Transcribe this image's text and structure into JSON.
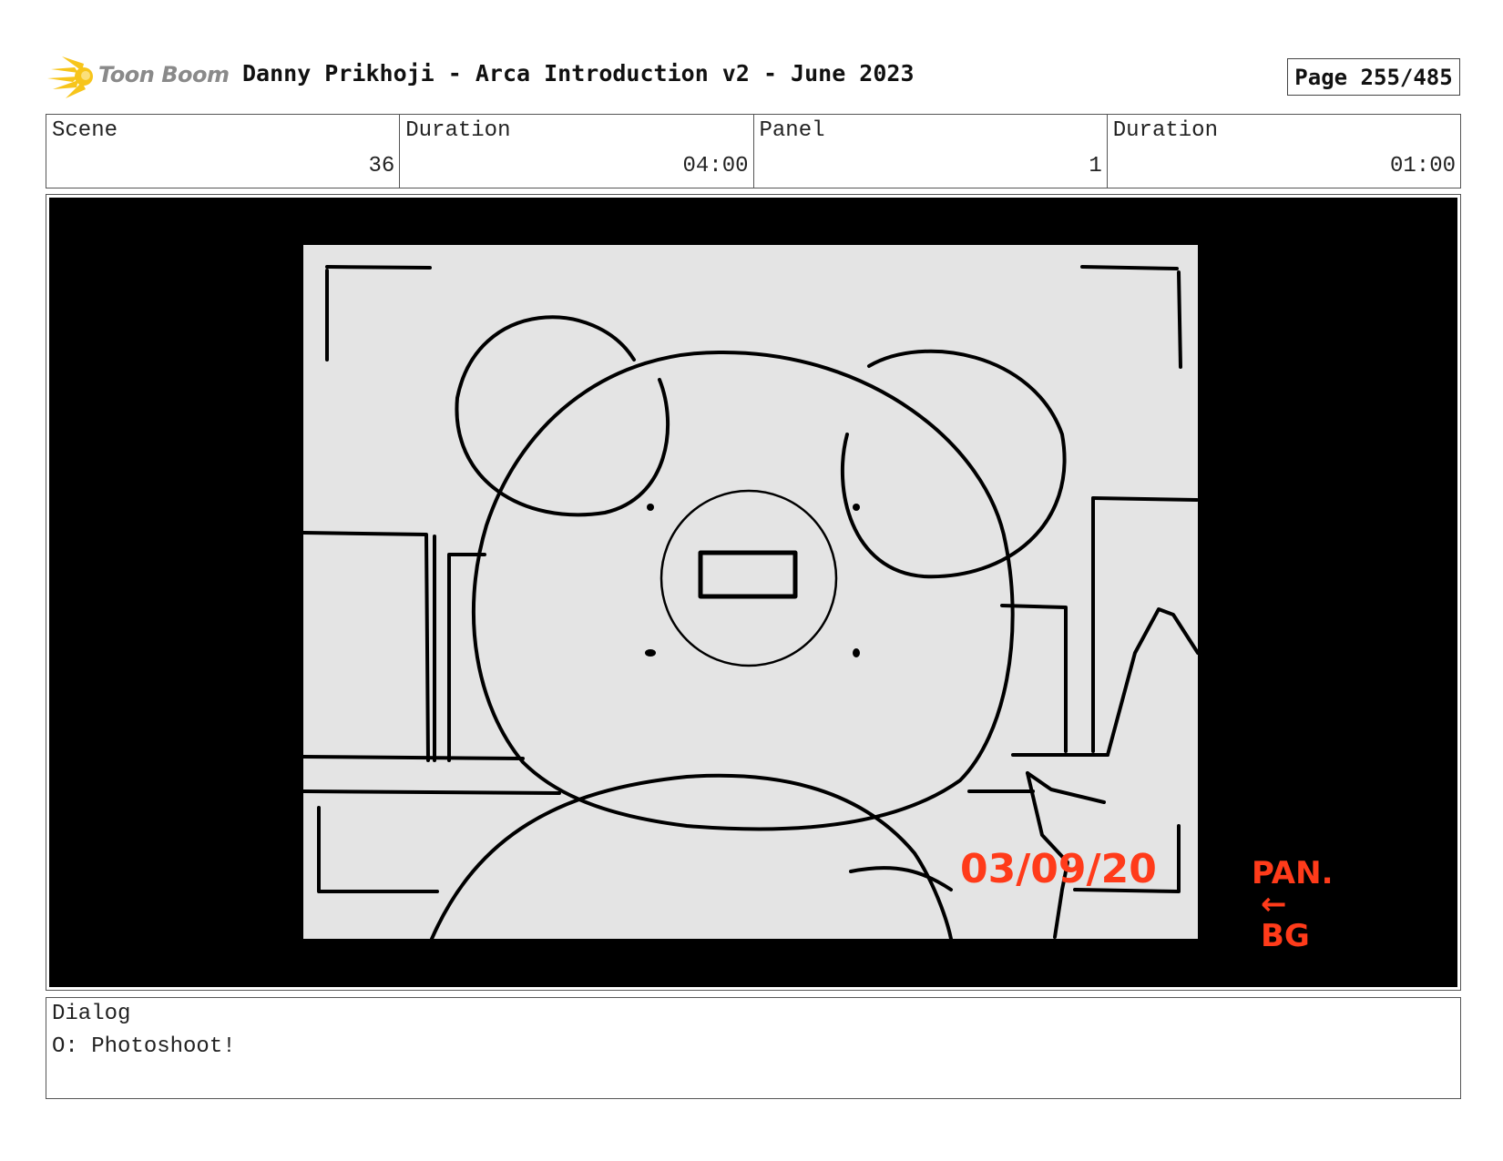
{
  "header": {
    "logo_text": "Toon Boom",
    "title": "Danny Prikhoji - Arca Introduction v2 - June 2023",
    "page": "Page 255/485"
  },
  "info": {
    "scene_label": "Scene",
    "scene_value": "36",
    "scene_duration_label": "Duration",
    "scene_duration_value": "04:00",
    "panel_label": "Panel",
    "panel_value": "1",
    "panel_duration_label": "Duration",
    "panel_duration_value": "01:00"
  },
  "panel": {
    "date_annotation": "03/09/20",
    "note_line1": "PAN.",
    "note_arrow": "←",
    "note_line2": "BG",
    "annotation_color": "#ff3b1a"
  },
  "dialog": {
    "label": "Dialog",
    "text": "O: Photoshoot!"
  }
}
